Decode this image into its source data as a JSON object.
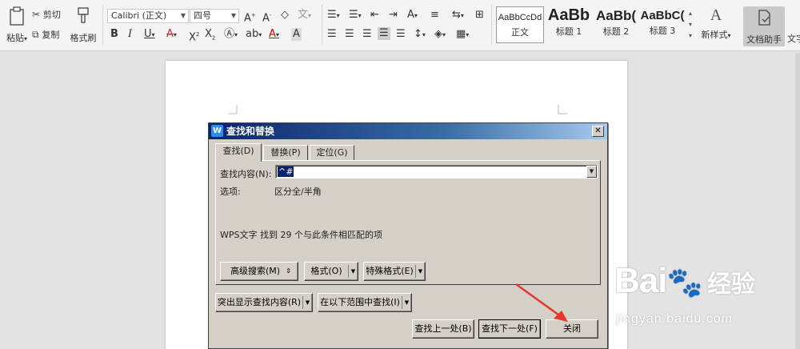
{
  "ribbon": {
    "paste_label": "粘贴",
    "cut_label": "剪切",
    "copy_label": "复制",
    "format_painter_label": "格式刷",
    "font_name": "Calibri (正文)",
    "font_size": "四号",
    "styles": [
      {
        "sample": "AaBbCcDd",
        "label": "正文"
      },
      {
        "sample": "AaBb",
        "label": "标题 1"
      },
      {
        "sample": "AaBb(",
        "label": "标题 2"
      },
      {
        "sample": "AaBbC(",
        "label": "标题 3"
      }
    ],
    "new_style_label": "新样式",
    "doc_assistant_label": "文档助手",
    "text_tools_label": "文字"
  },
  "dialog": {
    "title": "查找和替换",
    "tabs": [
      {
        "label": "查找(D)",
        "active": true
      },
      {
        "label": "替换(P)",
        "active": false
      },
      {
        "label": "定位(G)",
        "active": false
      }
    ],
    "find_label": "查找内容(N):",
    "find_value": "^#",
    "options_label": "选项:",
    "options_value": "区分全/半角",
    "result_text": "WPS文字 找到 29 个与此条件相匹配的项",
    "buttons": {
      "advanced_search": "高级搜索(M)",
      "format": "格式(O)",
      "special_format": "特殊格式(E)",
      "highlight": "突出显示查找内容(R)",
      "find_in": "在以下范围中查找(I)",
      "find_prev": "查找上一处(B)",
      "find_next": "查找下一处(F)",
      "close": "关闭"
    }
  },
  "watermark": {
    "brand": "Bai",
    "brand_paw": "du",
    "cn": "经验",
    "url": "jingyan.baidu.com"
  },
  "colors": {
    "title_start": "#0a246a",
    "title_end": "#a6caf0",
    "dialog_bg": "#d4d0c8",
    "arrow": "#e8362d"
  }
}
